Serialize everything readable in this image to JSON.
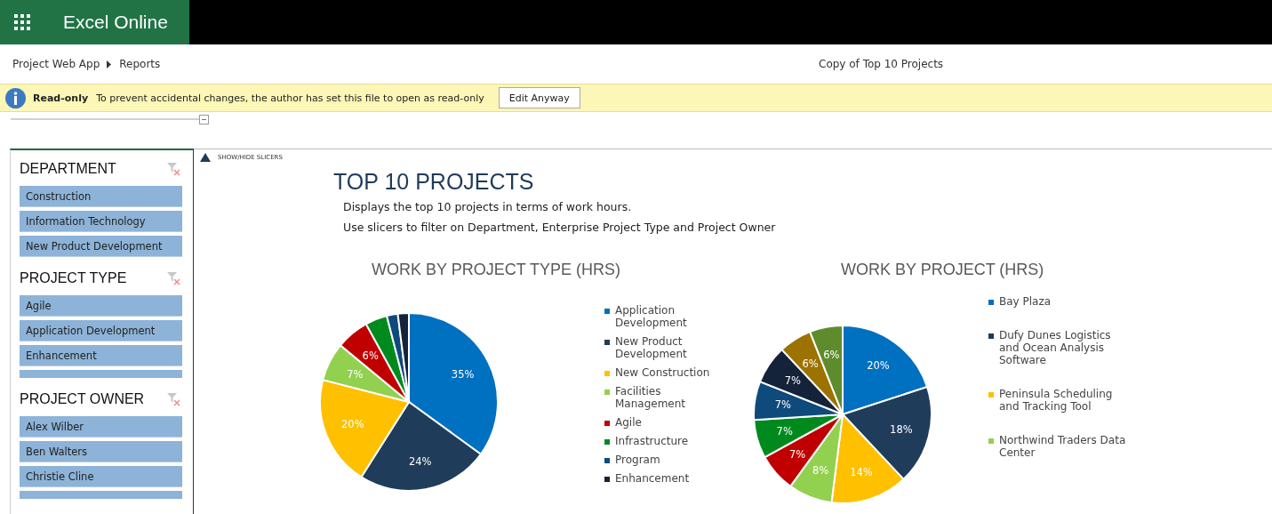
{
  "app": {
    "title": "Excel Online"
  },
  "breadcrumb": [
    "Project Web App",
    "Reports"
  ],
  "document_title": "Copy of Top 10 Projects",
  "infobar": {
    "label": "Read-only",
    "message": "To prevent accidental changes, the author has set this file to open as read-only",
    "button": "Edit Anyway"
  },
  "show_hide": "SHOW/HIDE SLICERS",
  "slicers": [
    {
      "title": "DEPARTMENT",
      "items": [
        "Construction",
        "Information Technology",
        "New Product Development"
      ],
      "more_items": false
    },
    {
      "title": "PROJECT TYPE",
      "items": [
        "Agile",
        "Application Development",
        "Enhancement"
      ],
      "more_items": true
    },
    {
      "title": "PROJECT OWNER",
      "items": [
        "Alex Wilber",
        "Ben Walters",
        "Christie Cline"
      ],
      "more_items": true
    }
  ],
  "report": {
    "title": "TOP 10 PROJECTS",
    "lines": [
      "Displays the top 10 projects in terms of work hours.",
      "Use slicers to filter on Department, Enterprise Project Type and Project Owner"
    ]
  },
  "charts": [
    {
      "chart_data": {
        "type": "pie",
        "title": "WORK BY PROJECT TYPE (HRS)",
        "categories": [
          "Application Development",
          "New Product Development",
          "New Construction",
          "Facilities Management",
          "Agile",
          "Infrastructure",
          "Program",
          "Enhancement"
        ],
        "values": [
          35,
          24,
          20,
          7,
          6,
          4,
          2,
          2
        ],
        "value_labels": [
          "35%",
          "24%",
          "20%",
          "7%",
          "6%",
          null,
          null,
          null
        ],
        "colors": [
          "#0070c0",
          "#203c5b",
          "#ffc000",
          "#92d050",
          "#c00000",
          "#008a1e",
          "#0f4a7c",
          "#14223a"
        ]
      }
    },
    {
      "chart_data": {
        "type": "pie",
        "title": "WORK BY PROJECT (HRS)",
        "categories": [
          "Bay Plaza",
          "Dufy Dunes Logistics and Ocean Analysis Software",
          "Peninsula Scheduling and Tracking Tool",
          "Northwind Traders Data Center",
          null,
          null,
          null,
          null,
          null,
          null
        ],
        "values": [
          20,
          18,
          14,
          8,
          7,
          7,
          7,
          7,
          6,
          6
        ],
        "value_labels": [
          "20%",
          "18%",
          "14%",
          "8%",
          "7%",
          "7%",
          "7%",
          "7%",
          "6%",
          "6%"
        ],
        "colors": [
          "#0070c0",
          "#203c5b",
          "#ffc000",
          "#92d050",
          "#c00000",
          "#008a1e",
          "#0f4a7c",
          "#14223a",
          "#9c7300",
          "#5e8c2c"
        ]
      }
    }
  ]
}
